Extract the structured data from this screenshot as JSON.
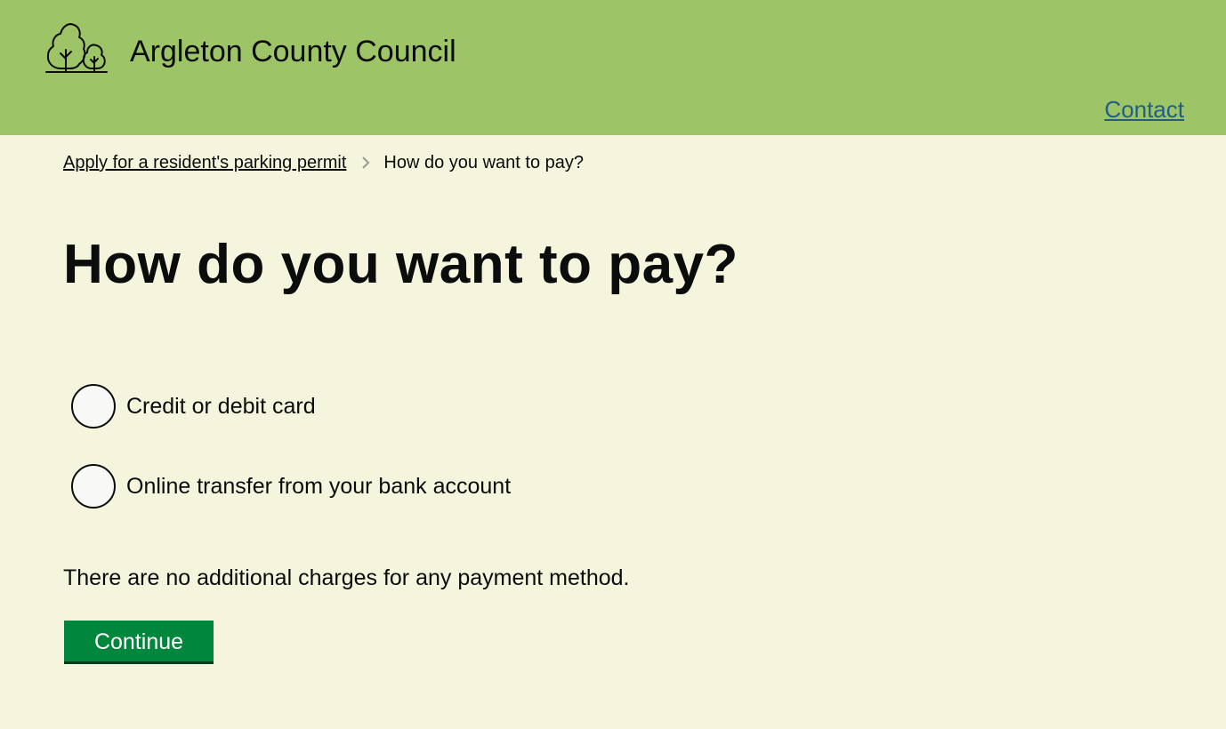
{
  "header": {
    "org_name": "Argleton County Council",
    "logo_icon": "trees-logo-icon",
    "contact_label": "Contact",
    "background": "#9dc466"
  },
  "breadcrumb": {
    "parent_label": "Apply for a resident's parking permit",
    "separator_icon": "chevron-right-icon",
    "current_label": "How do you want to pay?"
  },
  "main": {
    "title": "How do you want to pay?",
    "options": [
      {
        "label": "Credit or debit card",
        "selected": false
      },
      {
        "label": "Online transfer from your bank account",
        "selected": false
      }
    ],
    "hint": "There are no additional charges for any payment method.",
    "continue_label": "Continue"
  },
  "colors": {
    "page_background": "#f4f5dc",
    "button": "#00873d",
    "link": "#1d5f8a"
  }
}
